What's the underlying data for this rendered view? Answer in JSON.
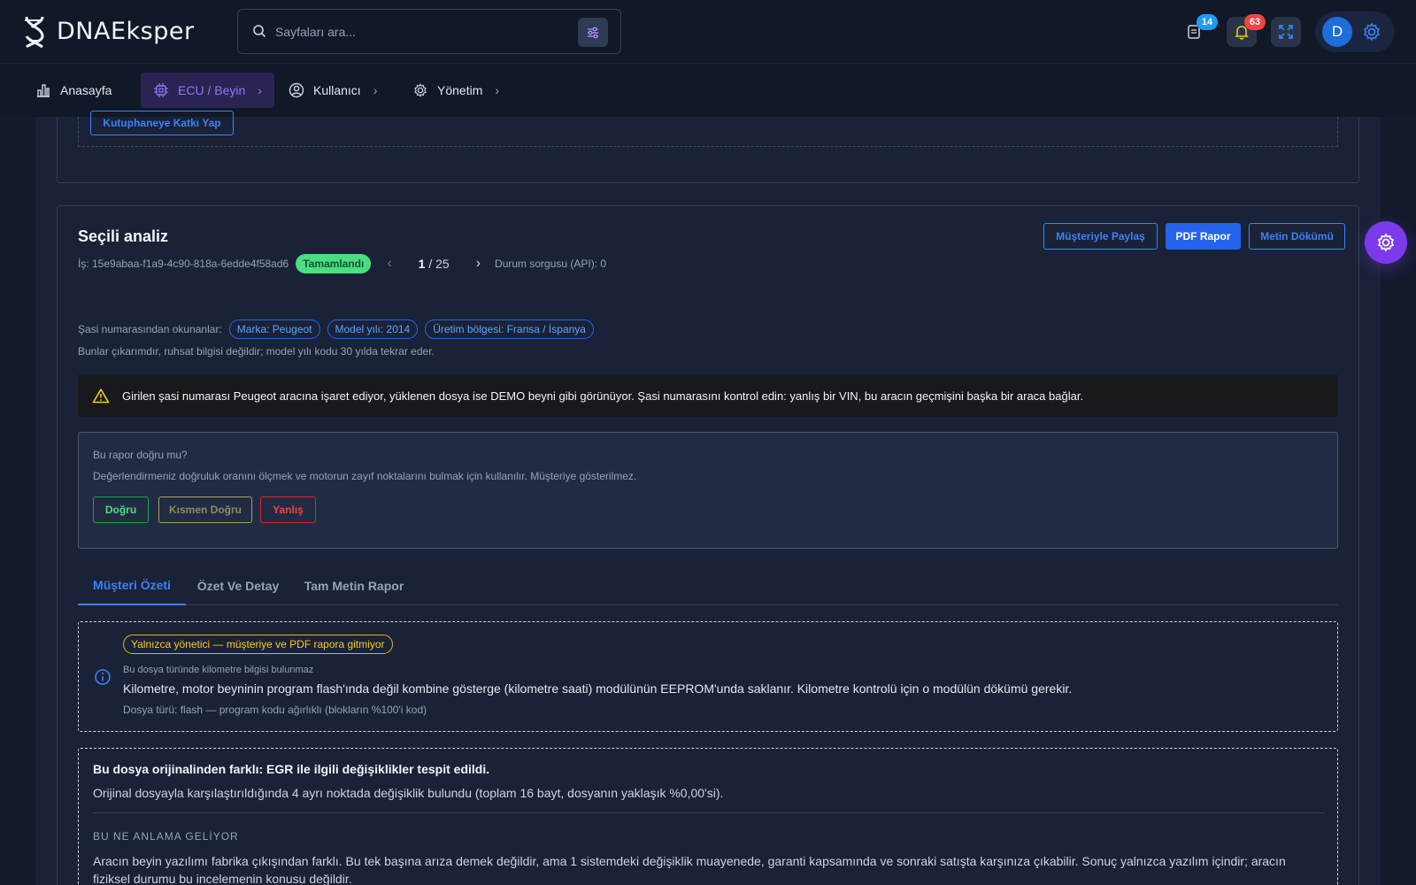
{
  "header": {
    "brand": "DNAEksper",
    "search": {
      "placeholder": "Sayfaları ara..."
    },
    "messages_count": "14",
    "notifications_count": "63",
    "user_initial": "D"
  },
  "nav": {
    "items": [
      {
        "label": "Anasayfa",
        "icon": "chart-bar-icon"
      },
      {
        "label": "ECU / Beyin",
        "icon": "chip-icon"
      },
      {
        "label": "Kullanıcı",
        "icon": "user-circle-icon"
      },
      {
        "label": "Yönetim",
        "icon": "gear-icon"
      }
    ]
  },
  "library": {
    "contribute_label": "Kutuphaneye Katkı Yap"
  },
  "analysis": {
    "title": "Seçili analiz",
    "job_id": "İş: 15e9abaa-f1a9-4c90-818a-6edde4f58ad6",
    "status": "Tamamlandı",
    "page_current": "1",
    "page_total": "/ 25",
    "api_status": "Durum sorgusu (API): 0",
    "actions": {
      "share": "Müşteriyle Paylaş",
      "pdf": "PDF Rapor",
      "text_dump": "Metin Dökümü"
    },
    "vin": {
      "label": "Şasi numarasından okunanlar:",
      "chips": [
        "Marka: Peugeot",
        "Model yılı: 2014",
        "Üretim bölgesi: Fransa / İspanya"
      ],
      "note": "Bunlar çıkarımdır, ruhsat bilgisi değildir; model yılı kodu 30 yılda tekrar eder."
    },
    "warning": "Girilen şasi numarası Peugeot aracına işaret ediyor, yüklenen dosya ise DEMO beyni gibi görünüyor. Şasi numarasını kontrol edin: yanlış bir VIN, bu aracın geçmişini başka bir araca bağlar.",
    "feedback": {
      "title": "Bu rapor doğru mu?",
      "description": "Değerlendirmeniz doğruluk oranını ölçmek ve motorun zayıf noktalarını bulmak için kullanılır. Müşteriye gösterilmez.",
      "correct": "Doğru",
      "partial": "Kısmen Doğru",
      "wrong": "Yanlış"
    },
    "tabs": [
      "Müşteri Özeti",
      "Özet Ve Detay",
      "Tam Metin Rapor"
    ],
    "info": {
      "admin_pill": "Yalnızca yönetici — müşteriye ve PDF rapora gitmiyor",
      "subtitle": "Bu dosya türünde kilometre bilgisi bulunmaz",
      "main": "Kilometre, motor beyninin program flash'ında değil kombine gösterge (kilometre saati) modülünün EEPROM'unda saklanır. Kilometre kontrolü için o modülün dökümü gerekir.",
      "file_type": "Dosya türü: flash — program kodu ağırlıklı (blokların %100'i kod)"
    },
    "diff": {
      "title": "Bu dosya orijinalinden farklı: EGR ile ilgili değişiklikler tespit edildi.",
      "subtitle": "Orijinal dosyayla karşılaştırıldığında 4 ayrı noktada değişiklik bulundu (toplam 16 bayt, dosyanın yaklaşık %0,00'si).",
      "meaning_heading": "BU NE ANLAMA GELİYOR",
      "meaning_body": "Aracın beyin yazılımı fabrika çıkışından farklı. Bu tek başına arıza demek değildir, ama 1 sistemdeki değişiklik muayenede, garanti kapsamında ve sonraki satışta karşınıza çıkabilir. Sonuç yalnızca yazılım içindir; aracın fiziksel durumu bu incelemenin konusu değildir."
    }
  },
  "colors": {
    "accent": "#3b82f6",
    "purple": "#8b7cf6",
    "success": "#4ade80",
    "warning": "#facc15",
    "danger": "#ef4444",
    "background": "#1a2238"
  }
}
